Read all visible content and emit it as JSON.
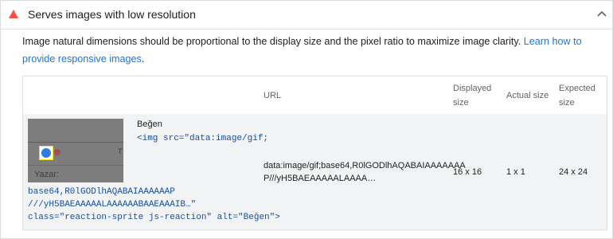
{
  "audit": {
    "title": "Serves images with low resolution",
    "description": "Image natural dimensions should be proportional to the display size and the pixel ratio to maximize image clarity. ",
    "link_text": "Learn how to provide responsive images",
    "description_end": ".",
    "status_color": "#ff4e42"
  },
  "table": {
    "headers": {
      "url": "URL",
      "displayed_line1": "Displayed",
      "displayed_line2": "size",
      "actual": "Actual size",
      "expected_line1": "Expected",
      "expected_line2": "size"
    },
    "row": {
      "thumbnail": {
        "author_label": "Yazar:",
        "edge_letter": "T"
      },
      "node_label": "Beğen",
      "snippet_line1": "<img src=\"data:image/gif;",
      "snippet_line2": "base64,R0lGODlhAQABAIAAAAAAP",
      "snippet_line3": "///yH5BAEAAAAALAAAAAABAAEAAAIB…\"",
      "snippet_line4": "class=\"reaction-sprite js-reaction\" alt=\"Beğen\">",
      "url_line1": "data:image/gif;base64,R0lGODlhAQABAIAAAAAAA",
      "url_line2": "P///yH5BAEAAAAALAAAA…",
      "displayed": "16 x 16",
      "actual": "1 x 1",
      "expected": "24 x 24"
    }
  }
}
